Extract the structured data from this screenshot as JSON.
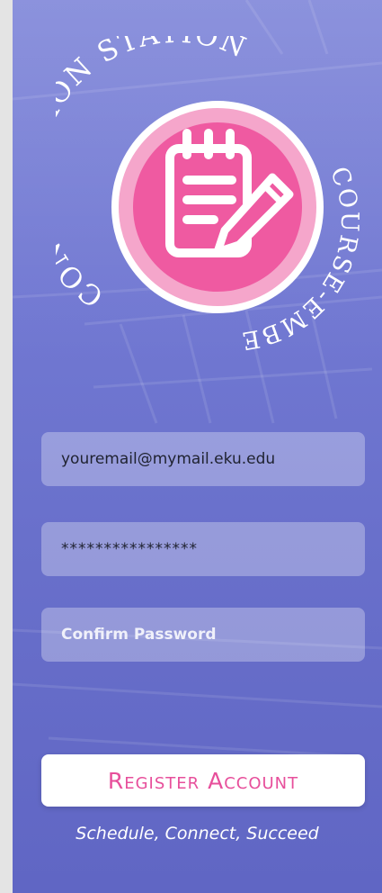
{
  "logo": {
    "arc_top": "CONSULTATION STATION",
    "arc_bottom": "COURSE-EMBEDDED",
    "icon": "notepad-pencil-icon",
    "badge_color": "#ef5aa1",
    "ring_color": "#f5a6cb"
  },
  "form": {
    "email_value": "youremail@mymail.eku.edu",
    "password_value": "****************",
    "confirm_placeholder": "Confirm Password"
  },
  "register": {
    "label": "Register Account",
    "color": "#e74f9b"
  },
  "tagline": "Schedule, Connect, Succeed"
}
